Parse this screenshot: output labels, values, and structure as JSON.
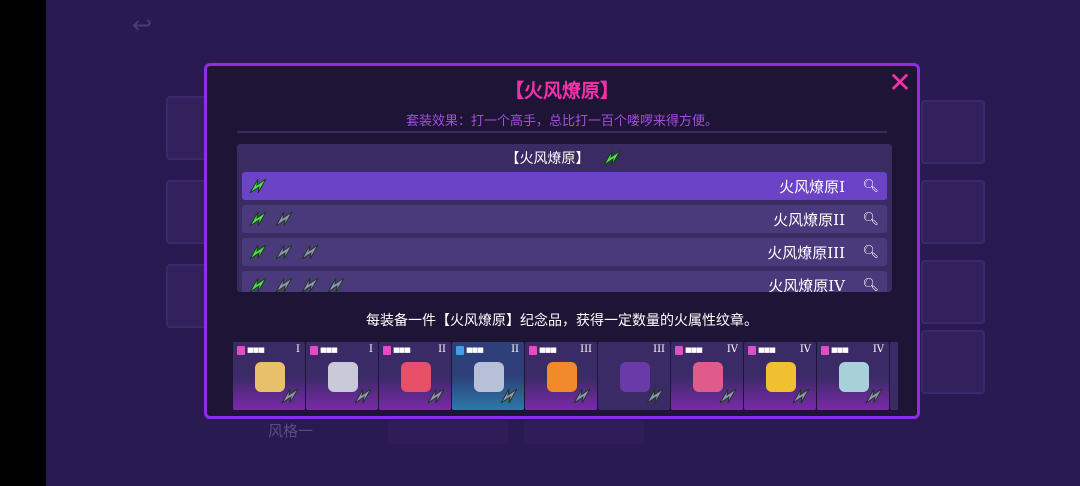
{
  "title": "【火风燎原】",
  "subtitle": "套装效果：打一个高手，总比打一百个喽啰来得方便。",
  "set_header": "【火风燎原】",
  "sets": [
    {
      "name": "火风燎原I",
      "level": 1,
      "active": 1,
      "selected": true
    },
    {
      "name": "火风燎原II",
      "level": 2,
      "active": 1,
      "selected": false
    },
    {
      "name": "火风燎原III",
      "level": 3,
      "active": 1,
      "selected": false
    },
    {
      "name": "火风燎原IV",
      "level": 4,
      "active": 1,
      "selected": false
    }
  ],
  "bottom_text": "每装备一件【火风燎原】纪念品，获得一定数量的火属性纹章。",
  "items": [
    {
      "tier": "I",
      "badge": "pink",
      "art_color": "#e8c06a",
      "selected": false
    },
    {
      "tier": "I",
      "badge": "pink",
      "art_color": "#c9c9d9",
      "selected": false
    },
    {
      "tier": "II",
      "badge": "pink",
      "art_color": "#e8506a",
      "selected": false
    },
    {
      "tier": "II",
      "badge": "blue",
      "art_color": "#b8c0d8",
      "selected": true
    },
    {
      "tier": "III",
      "badge": "pink",
      "art_color": "#f08a2a",
      "selected": false
    },
    {
      "tier": "III",
      "badge": "none",
      "art_color": "#6a3aa8",
      "selected": false
    },
    {
      "tier": "IV",
      "badge": "pink",
      "art_color": "#e05a8a",
      "selected": false
    },
    {
      "tier": "IV",
      "badge": "pink",
      "art_color": "#f0c030",
      "selected": false
    },
    {
      "tier": "IV",
      "badge": "pink",
      "art_color": "#a8d0d8",
      "selected": false
    }
  ],
  "background_label": "风格一",
  "colors": {
    "accent": "#f233a8",
    "panel_border": "#8d2ee6",
    "bolt_active": "#4ce04c",
    "bolt_inactive": "#9a8fc0"
  }
}
